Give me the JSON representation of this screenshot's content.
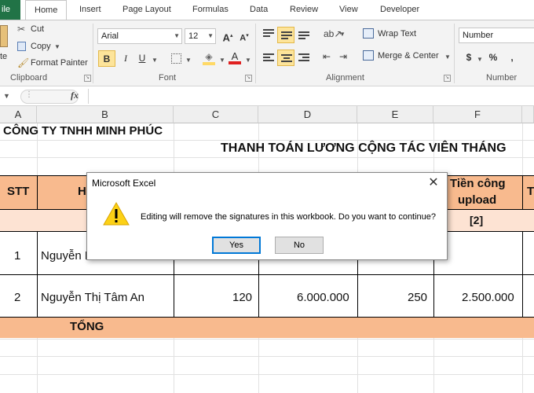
{
  "ribbon_tabs": [
    "ile",
    "Home",
    "Insert",
    "Page Layout",
    "Formulas",
    "Data",
    "Review",
    "View",
    "Developer"
  ],
  "clipboard": {
    "paste_label": "te",
    "cut": "Cut",
    "copy": "Copy",
    "format_painter": "Format Painter",
    "group_label": "Clipboard"
  },
  "font": {
    "name": "Arial",
    "size": "12",
    "bold": "B",
    "italic": "I",
    "underline": "U",
    "group_label": "Font"
  },
  "alignment": {
    "wrap_text": "Wrap Text",
    "merge_center": "Merge & Center",
    "group_label": "Alignment"
  },
  "number": {
    "format": "Number",
    "currency": "$",
    "percent": "%",
    "comma": ",",
    "group_label": "Number"
  },
  "formula_bar": {
    "fx": "fx",
    "value": ""
  },
  "columns": [
    "A",
    "B",
    "C",
    "D",
    "E",
    "F",
    ""
  ],
  "sheet": {
    "company": "CÔNG TY TNHH MINH PHÚC",
    "title": "THANH TOÁN LƯƠNG CỘNG TÁC VIÊN THÁNG",
    "header_stt": "STT",
    "header_b_partial": "H",
    "header_f": [
      "Tiền công",
      "upload"
    ],
    "header_g_partial": "T",
    "subheader_f": "[2]",
    "row1": {
      "stt": "1",
      "name": "Nguyễn M"
    },
    "row2": {
      "stt": "2",
      "name": "Nguyễn Thị Tâm An",
      "c": "120",
      "d": "6.000.000",
      "e": "250",
      "f": "2.500.000"
    },
    "total_label": "TỔNG"
  },
  "dialog": {
    "title": "Microsoft Excel",
    "close": "✕",
    "message": "Editing will remove the signatures in this workbook. Do you want to continue?",
    "yes": "Yes",
    "no": "No"
  },
  "colors": {
    "file_tab": "#217346",
    "header_fill": "#f8ba8e",
    "subheader_fill": "#fde3d3",
    "highlight": "#fde49a"
  }
}
